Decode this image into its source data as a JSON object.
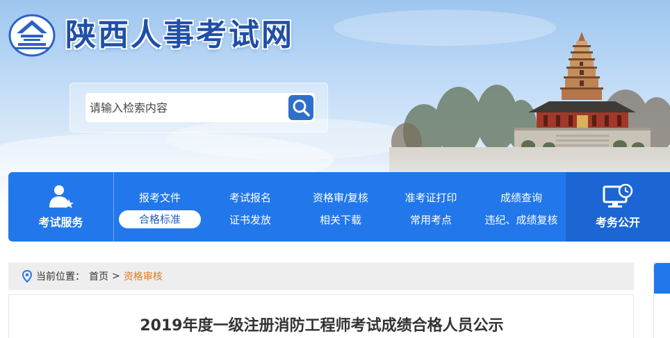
{
  "site": {
    "title": "陕西人事考试网"
  },
  "search": {
    "placeholder": "请输入检索内容",
    "button_icon": "search-icon"
  },
  "nav": {
    "left": {
      "label": "考试服务",
      "icon": "user-star-icon"
    },
    "items": [
      {
        "label": "报考文件"
      },
      {
        "label": "考试报名"
      },
      {
        "label": "资格审/复核"
      },
      {
        "label": "准考证打印"
      },
      {
        "label": "成绩查询"
      },
      {
        "label": "合格标准",
        "active": true
      },
      {
        "label": "证书发放"
      },
      {
        "label": "相关下载"
      },
      {
        "label": "常用考点"
      },
      {
        "label": "违纪、成绩复核"
      }
    ],
    "right": {
      "label": "考务公开",
      "icon": "monitor-clock-icon"
    }
  },
  "breadcrumb": {
    "prefix": "当前位置：",
    "home": "首页",
    "separator": ">",
    "current": "资格审核"
  },
  "article": {
    "title": "2019年度一级注册消防工程师考试成绩合格人员公示"
  },
  "colors": {
    "nav_blue": "#2278ea",
    "title_blue": "#1f4fa7",
    "breadcrumb_current": "#e07b1b"
  }
}
